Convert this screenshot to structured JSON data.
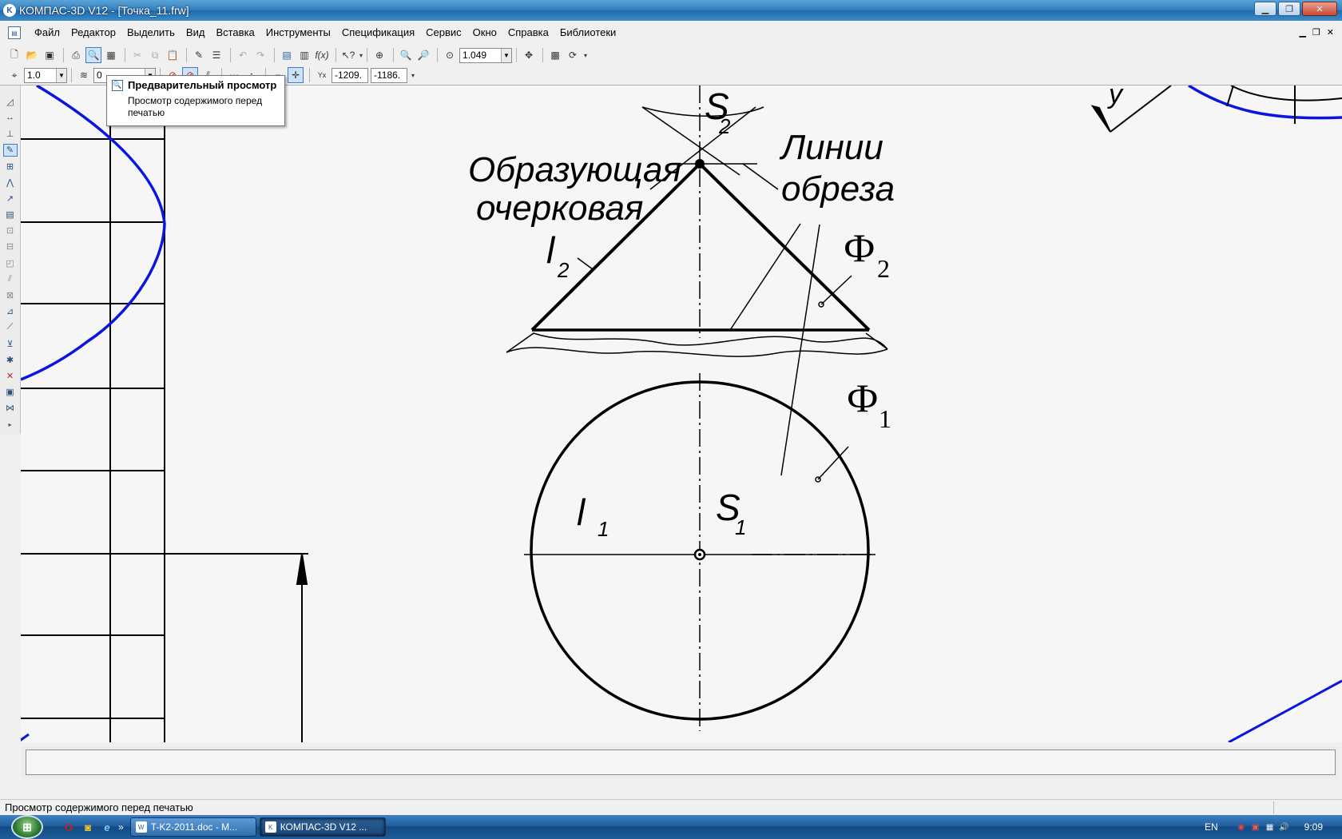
{
  "window": {
    "title": "КОМПАС-3D V12 - [Точка_11.frw]",
    "app_icon": "kompas-logo-icon",
    "controls": [
      "minimize",
      "maximize",
      "close"
    ]
  },
  "menu": {
    "items": [
      "Файл",
      "Редактор",
      "Выделить",
      "Вид",
      "Вставка",
      "Инструменты",
      "Спецификация",
      "Сервис",
      "Окно",
      "Справка",
      "Библиотеки"
    ]
  },
  "toolbar": {
    "zoom_value": "1.049",
    "step_value": "1.0",
    "layer_value": "0",
    "coord_x": "-1209.",
    "coord_y": "-1186."
  },
  "tooltip": {
    "title": "Предварительный просмотр",
    "description": "Просмотр содержимого перед печатью"
  },
  "drawing": {
    "labels": {
      "generatrix": "Образующая",
      "generatrix_2": "очерковая",
      "l2": "l",
      "l2_sub": "2",
      "s2": "S",
      "s2_sub": "2",
      "cut_lines": "Линии",
      "cut_lines_2": "обреза",
      "phi2": "Ф",
      "phi2_sub": "2",
      "phi1": "Ф",
      "phi1_sub": "1",
      "l1": "l",
      "l1_sub": "1",
      "s1": "S",
      "s1_sub": "1",
      "y_axis": "y"
    },
    "colors": {
      "ink": "#000000",
      "curve": "#0a16e0",
      "background": "#f6f6f6"
    }
  },
  "statusbar": {
    "text": "Просмотр содержимого перед печатью"
  },
  "taskbar": {
    "tasks": [
      {
        "label": "T-K2-2011.doc - M...",
        "icon": "word-doc-icon",
        "active": false
      },
      {
        "label": "КОМПАС-3D V12 ...",
        "icon": "kompas-logo-icon",
        "active": true
      }
    ],
    "language": "EN",
    "clock": "9:09"
  }
}
